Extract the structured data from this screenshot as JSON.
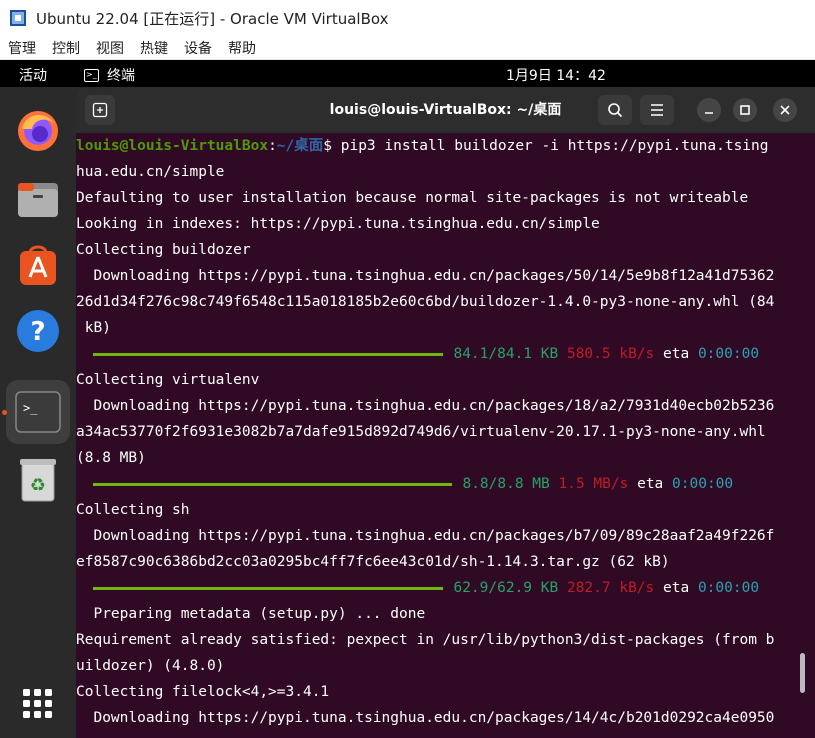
{
  "vbox": {
    "title": "Ubuntu 22.04 [正在运行] - Oracle VM VirtualBox",
    "menu": [
      "管理",
      "控制",
      "视图",
      "热键",
      "设备",
      "帮助"
    ]
  },
  "topbar": {
    "activities": "活动",
    "app_name": "终端",
    "app_icon_glyph": ">_",
    "clock": "1月9日  14：42"
  },
  "dock": {
    "items": [
      "firefox-icon",
      "files-icon",
      "app-center-icon",
      "help-icon",
      "terminal-icon",
      "trash-icon",
      "show-apps-icon"
    ],
    "running_indicator_color": "#e95420"
  },
  "terminal": {
    "title": "louis@louis-VirtualBox: ~/桌面",
    "prompt_user": "louis@louis-VirtualBox",
    "prompt_sep": ":",
    "prompt_path": "~/桌面",
    "prompt_end": "$ ",
    "command": "pip3 install buildozer -i https://pypi.tuna.tsing",
    "lines": {
      "l2": "hua.edu.cn/simple",
      "l3": "Defaulting to user installation because normal site-packages is not writeable",
      "l4": "Looking in indexes: https://pypi.tuna.tsinghua.edu.cn/simple",
      "l5": "Collecting buildozer",
      "l6": "  Downloading https://pypi.tuna.tsinghua.edu.cn/packages/50/14/5e9b8f12a41d75362",
      "l7": "26d1d34f276c98c749f6548c115a018185b2e60c6bd/buildozer-1.4.0-py3-none-any.whl (84",
      "l8": " kB)",
      "l10": "Collecting virtualenv",
      "l11": "  Downloading https://pypi.tuna.tsinghua.edu.cn/packages/18/a2/7931d40ecb02b5236",
      "l12": "a34ac53770f2f6931e3082b7a7dafe915d892d749d6/virtualenv-20.17.1-py3-none-any.whl",
      "l13": "(8.8 MB)",
      "l15": "Collecting sh",
      "l16": "  Downloading https://pypi.tuna.tsinghua.edu.cn/packages/b7/09/89c28aaf2a49f226f",
      "l17": "ef8587c90c6386bd2cc03a0295bc4ff7fc6ee43c01d/sh-1.14.3.tar.gz (62 kB)",
      "l19": "  Preparing metadata (setup.py) ... done",
      "l20": "Requirement already satisfied: pexpect in /usr/lib/python3/dist-packages (from b",
      "l21": "uildozer) (4.8.0)",
      "l22": "Collecting filelock<4,>=3.4.1",
      "l23": "  Downloading https://pypi.tuna.tsinghua.edu.cn/packages/14/4c/b201d0292ca4e0950"
    },
    "progress": [
      {
        "size": "84.1/84.1 KB",
        "rate": "580.5 kB/s",
        "eta_label": "eta",
        "eta": "0:00:00",
        "fraction": 1.0
      },
      {
        "size": "8.8/8.8 MB",
        "rate": "1.5 MB/s",
        "eta_label": "eta",
        "eta": "0:00:00",
        "fraction": 1.0
      },
      {
        "size": "62.9/62.9 KB",
        "rate": "282.7 kB/s",
        "eta_label": "eta",
        "eta": "0:00:00",
        "fraction": 1.0
      }
    ]
  },
  "colors": {
    "terminal_bg": "#300a24",
    "prompt_user": "#4e9a06",
    "prompt_path": "#3465a4",
    "progress_bar": "#73b50f"
  }
}
